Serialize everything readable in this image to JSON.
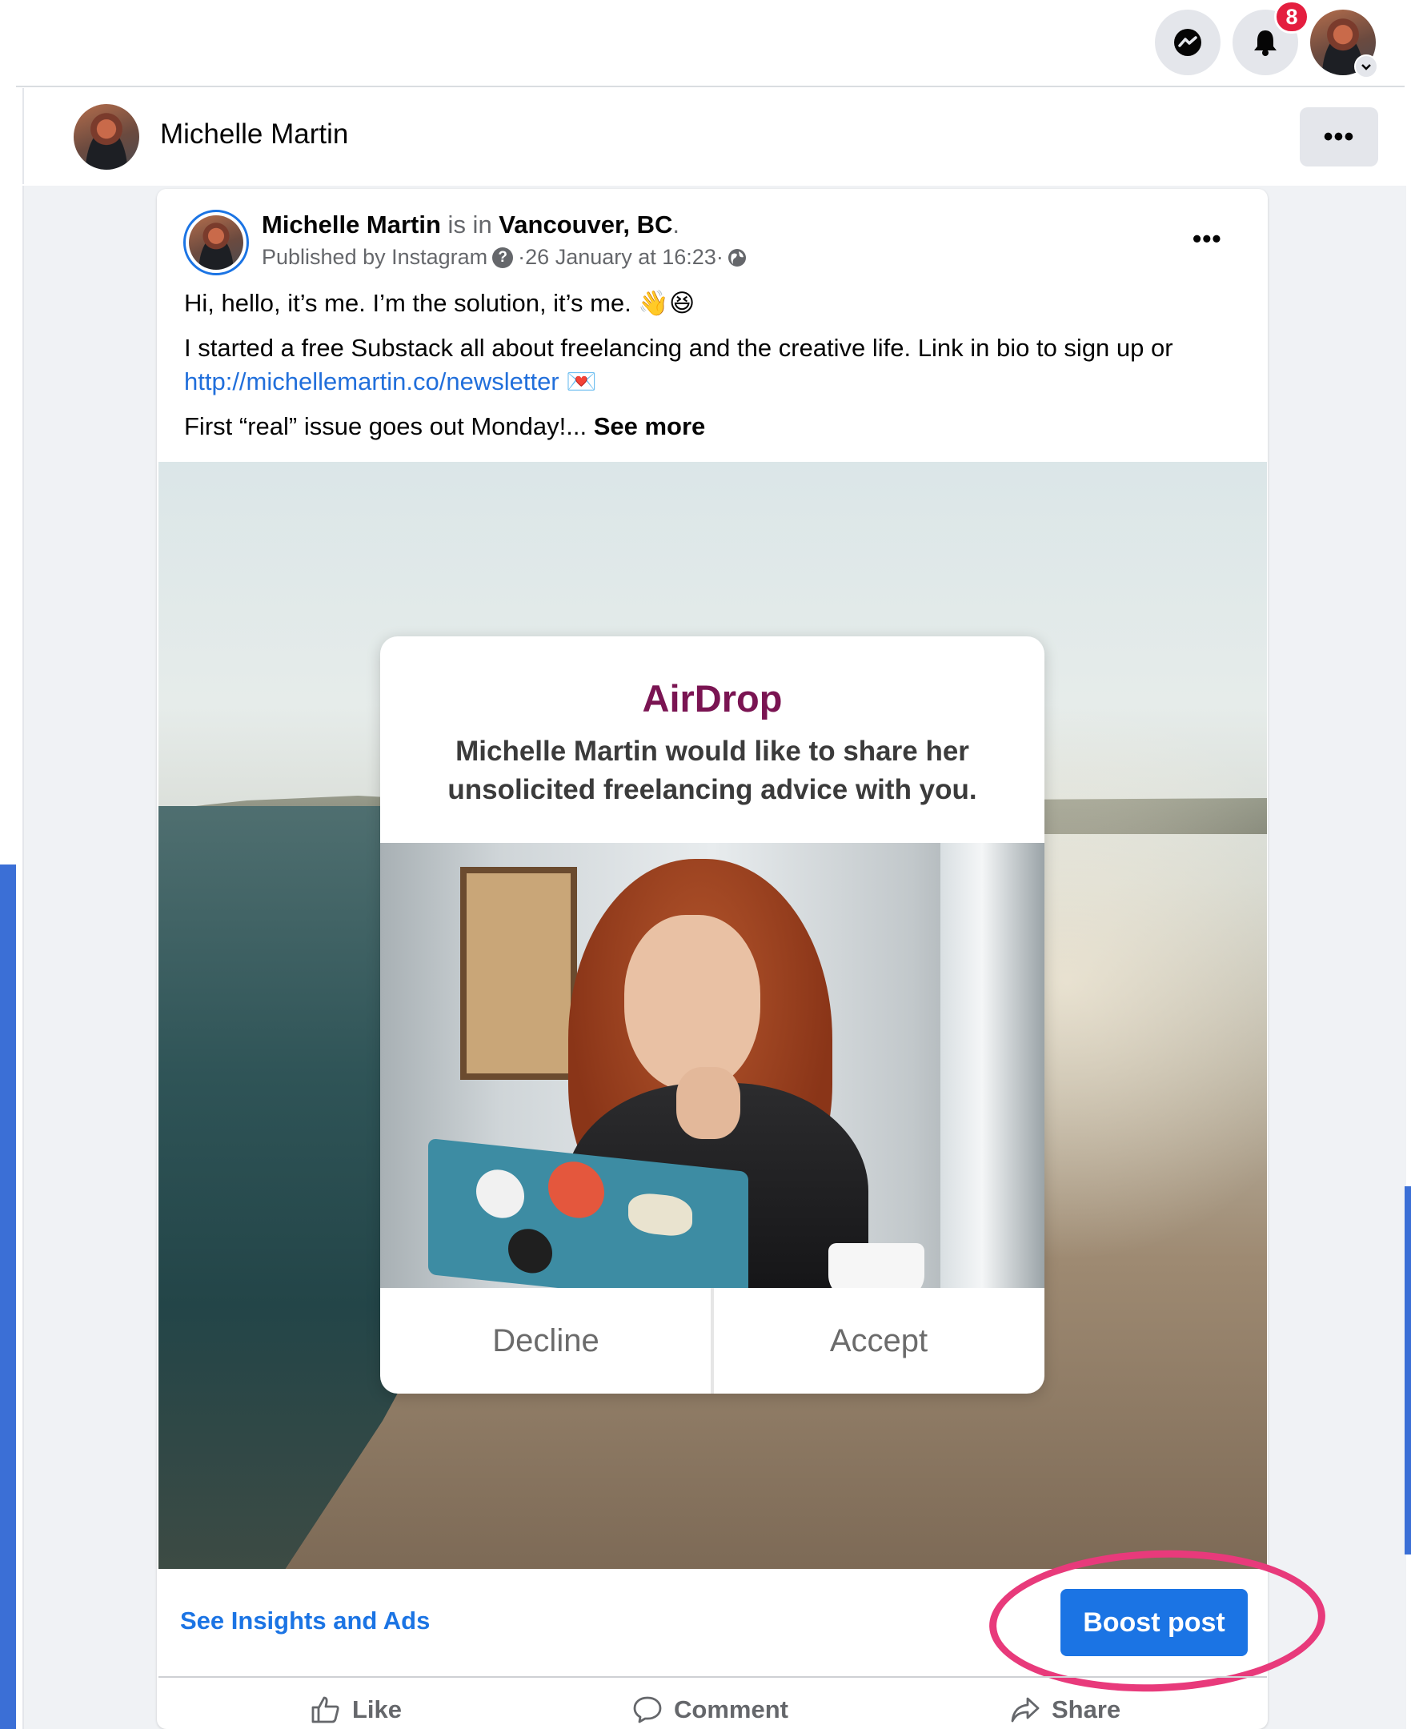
{
  "topbar": {
    "messenger_icon": "messenger-icon",
    "notifications_icon": "bell-icon",
    "notification_count": "8"
  },
  "page_header": {
    "name": "Michelle Martin",
    "more_label": "•••"
  },
  "post": {
    "author": "Michelle Martin",
    "is_in": " is in ",
    "location": "Vancouver, BC",
    "period": ".",
    "published_by": "Published by Instagram",
    "sep1": " · ",
    "timestamp": "26 January at 16:23",
    "sep2": " · ",
    "more_label": "•••",
    "line1": "Hi, hello, it’s me. I’m the solution, it’s me. 👋😆",
    "line2": "I started a free Substack all about freelancing and the creative life. Link in bio to sign up or",
    "link": "http://michellemartin.co/newsletter",
    "link_emoji": "💌",
    "line3": "First “real” issue goes out Monday!... ",
    "see_more": "See more"
  },
  "dialog": {
    "title": "AirDrop",
    "body": "Michelle Martin would like to share her unsolicited freelancing advice with you.",
    "decline": "Decline",
    "accept": "Accept"
  },
  "footer": {
    "insights": "See Insights and Ads",
    "boost": "Boost post",
    "like": "Like",
    "comment": "Comment",
    "share": "Share"
  },
  "colors": {
    "accent": "#1b74e4",
    "highlight": "#e83a7b",
    "airdrop_title": "#7a1452",
    "badge": "#e41e3f"
  }
}
